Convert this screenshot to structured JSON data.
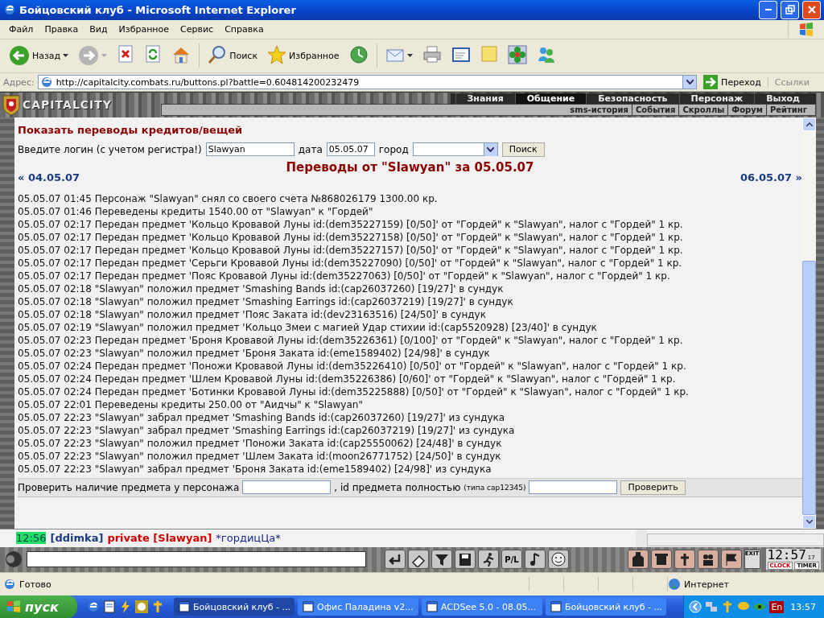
{
  "window": {
    "title": "Бойцовский клуб - Microsoft Internet Explorer"
  },
  "menu": [
    "Файл",
    "Правка",
    "Вид",
    "Избранное",
    "Сервис",
    "Справка"
  ],
  "toolbar": [
    {
      "kind": "back",
      "label": "Назад"
    },
    {
      "kind": "forward"
    },
    {
      "kind": "stop"
    },
    {
      "kind": "refresh"
    },
    {
      "kind": "home"
    },
    {
      "kind": "search",
      "label": "Поиск"
    },
    {
      "kind": "favorites",
      "label": "Избранное"
    },
    {
      "kind": "history"
    },
    {
      "kind": "mail"
    },
    {
      "kind": "print"
    },
    {
      "kind": "edit"
    },
    {
      "kind": "note"
    },
    {
      "kind": "flower"
    },
    {
      "kind": "people"
    }
  ],
  "address": {
    "label": "Адрес:",
    "url": "http://capitalcity.combats.ru/buttons.pl?battle=0.604814200232479",
    "go": "Переход",
    "links": "Ссылки"
  },
  "game_header": {
    "logo": "CAPITALCITY",
    "tabs": [
      {
        "label": "Знания",
        "selected": false
      },
      {
        "label": "Общение",
        "selected": true
      },
      {
        "label": "Безопасность",
        "selected": false
      },
      {
        "label": "Персонаж",
        "selected": false
      },
      {
        "label": "Выход",
        "selected": false
      }
    ],
    "subnav": [
      "sms-история",
      "События",
      "Скроллы",
      "Форум",
      "Рейтинг"
    ]
  },
  "content": {
    "heading": "Показать переводы кредитов/вещей",
    "login_label": "Введите логин (с учетом регистра!)",
    "login_value": "Slawyan",
    "date_label": "дата",
    "date_value": "05.05.07",
    "city_label": "город",
    "search_button": "Поиск",
    "prev_link": "« 04.05.07",
    "title": "Переводы от \"Slawyan\" за 05.05.07",
    "next_link": "06.05.07 »",
    "log": [
      "05.05.07 01:45 Персонаж \"Slawyan\" снял со своего счета №868026179 1300.00 кр.",
      "05.05.07 01:46 Переведены кредиты 1540.00 от \"Slawyan\" к \"Гордей\"",
      "05.05.07 02:17 Передан предмет 'Кольцо Кровавой Луны id:(dem35227159) [0/50]' от \"Гордей\" к \"Slawyan\", налог с \"Гордей\" 1 кр.",
      "05.05.07 02:17 Передан предмет 'Кольцо Кровавой Луны id:(dem35227158) [0/50]' от \"Гордей\" к \"Slawyan\", налог с \"Гордей\" 1 кр.",
      "05.05.07 02:17 Передан предмет 'Кольцо Кровавой Луны id:(dem35227157) [0/50]' от \"Гордей\" к \"Slawyan\", налог с \"Гордей\" 1 кр.",
      "05.05.07 02:17 Передан предмет 'Серьги Кровавой Луны id:(dem35227090) [0/50]' от \"Гордей\" к \"Slawyan\", налог с \"Гордей\" 1 кр.",
      "05.05.07 02:17 Передан предмет 'Пояс Кровавой Луны id:(dem35227063) [0/50]' от \"Гордей\" к \"Slawyan\", налог с \"Гордей\" 1 кр.",
      "05.05.07 02:18 \"Slawyan\" положил предмет 'Smashing Bands id:(cap26037260) [19/27]' в сундук",
      "05.05.07 02:18 \"Slawyan\" положил предмет 'Smashing Earrings id:(cap26037219) [19/27]' в сундук",
      "05.05.07 02:18 \"Slawyan\" положил предмет 'Пояс Заката id:(dev23163516) [24/50]' в сундук",
      "05.05.07 02:19 \"Slawyan\" положил предмет 'Кольцо Змеи с магией Удар стихии id:(cap5520928) [23/40]' в сундук",
      "05.05.07 02:23 Передан предмет 'Броня Кровавой Луны id:(dem35226361) [0/100]' от \"Гордей\" к \"Slawyan\", налог с \"Гордей\" 1 кр.",
      "05.05.07 02:23 \"Slawyan\" положил предмет 'Броня Заката id:(eme1589402) [24/98]' в сундук",
      "05.05.07 02:24 Передан предмет 'Поножи Кровавой Луны id:(dem35226410) [0/50]' от \"Гордей\" к \"Slawyan\", налог с \"Гордей\" 1 кр.",
      "05.05.07 02:24 Передан предмет 'Шлем Кровавой Луны id:(dem35226386) [0/60]' от \"Гордей\" к \"Slawyan\", налог с \"Гордей\" 1 кр.",
      "05.05.07 02:24 Передан предмет 'Ботинки Кровавой Луны id:(dem35225888) [0/50]' от \"Гордей\" к \"Slawyan\", налог с \"Гордей\" 1 кр.",
      "05.05.07 22:01 Переведены кредиты 250.00 от \"Аидчы\" к \"Slawyan\"",
      "05.05.07 22:23 \"Slawyan\" забрал предмет 'Smashing Bands id:(cap26037260) [19/27]' из сундука",
      "05.05.07 22:23 \"Slawyan\" забрал предмет 'Smashing Earrings id:(cap26037219) [19/27]' из сундука",
      "05.05.07 22:23 \"Slawyan\" положил предмет 'Поножи Заката id:(cap25550062) [24/48]' в сундук",
      "05.05.07 22:23 \"Slawyan\" положил предмет 'Шлем Заката id:(moon26771752) [24/50]' в сундук",
      "05.05.07 22:23 \"Slawyan\" забрал предмет 'Броня Заката id:(eme1589402) [24/98]' из сундука"
    ],
    "check": {
      "label": "Проверить наличие предмета у персонажа",
      "id_label": ", id предмета полностью",
      "id_hint": "(типа cap12345)",
      "button": "Проверить"
    }
  },
  "chat": {
    "time": "12:56",
    "sender": "[ddimka]",
    "private": "private [Slawyan]",
    "text": "*гордицЦа*"
  },
  "game_toolbar": {
    "pl_label": "P/L",
    "exit": "EXIT",
    "clock": "12:57",
    "seconds": "17",
    "clock_label": "CLOCK",
    "timer_label": "TIMER"
  },
  "status_bar": {
    "text": "Готово",
    "zone": "Интернет"
  },
  "taskbar": {
    "start": "пуск",
    "tasks": [
      {
        "label": "Бойцовский клуб - ...",
        "selected": true
      },
      {
        "label": "Офис Паладина v2...",
        "selected": false
      },
      {
        "label": "ACDSee 5.0 - 08.05...",
        "selected": false
      },
      {
        "label": "Бойцовский клуб - ...",
        "selected": false
      }
    ],
    "lang": "En",
    "clock": "13:57"
  }
}
